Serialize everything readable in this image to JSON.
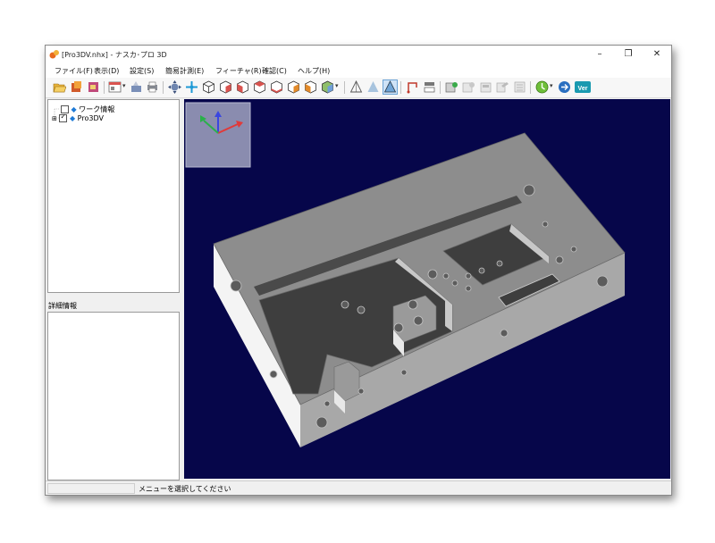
{
  "window": {
    "title": "[Pro3DV.nhx] - ナスカ･プロ 3D",
    "minimize_glyph": "–",
    "restore_glyph": "❐",
    "close_glyph": "✕"
  },
  "menu": {
    "items": [
      "ファイル(F)",
      "表示(D)",
      "設定(S)",
      "簡易計測(E)",
      "フィーチャ(R)",
      "確認(C)",
      "ヘルプ(H)"
    ]
  },
  "tree": {
    "items": [
      {
        "label": "ワーク情報",
        "checked": false
      },
      {
        "label": "Pro3DV",
        "checked": true
      }
    ]
  },
  "detail": {
    "label": "詳細情報"
  },
  "status": {
    "message": "メニューを選択してください"
  },
  "viewport": {
    "background": "#06064a"
  },
  "toolbar": {
    "version_badge": "Ver"
  }
}
